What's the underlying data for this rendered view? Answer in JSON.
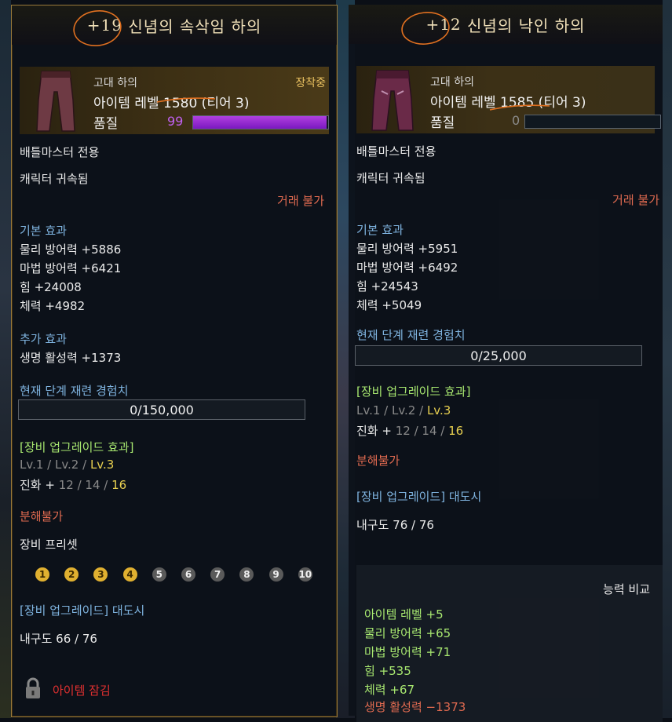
{
  "left": {
    "title_plus": "+19",
    "title_name": " 신념의 속삭임 하의",
    "item_type": "고대 하의",
    "equipped": "장착중",
    "level_prefix": "아이템 레벨 ",
    "level_value": "1580",
    "tier": " (티어 3)",
    "quality_label": "품질",
    "quality_value": "99",
    "quality": 0.99,
    "class_req": "배틀마스터 전용",
    "bound": "캐릭터 귀속됨",
    "trade": "거래 불가",
    "base_title": "기본 효과",
    "base": [
      "물리 방어력 +5886",
      "마법 방어력 +6421",
      "힘 +24008",
      "체력 +4982"
    ],
    "extra_title": "추가 효과",
    "extra": [
      "생명 활성력 +1373"
    ],
    "xp_title": "현재 단계 재련 경험치",
    "xp_value": "0/150,000",
    "upgrade_title": "[장비 업그레이드 효과]",
    "upgrade_lv12": "Lv.1 / Lv.2 / ",
    "upgrade_lv3": "Lv.3",
    "evo_prefix": "진화 + ",
    "evo_gray": "12 / 14 / ",
    "evo_yellow": "16",
    "disassemble": "분해불가",
    "preset_title": "장비 프리셋",
    "presets": [
      "1",
      "2",
      "3",
      "4",
      "5",
      "6",
      "7",
      "8",
      "9",
      "10"
    ],
    "presets_active": 4,
    "upgrade_city": "[장비 업그레이드] 대도시",
    "durability": "내구도 66 / 76",
    "lock_label": "아이템 잠김"
  },
  "right": {
    "title_plus": "+12",
    "title_name": " 신념의 낙인 하의",
    "item_type": "고대 하의",
    "level_prefix": "아이템 레벨 ",
    "level_value": "1585",
    "tier": " (티어 3)",
    "quality_label": "품질",
    "quality_value": "0",
    "quality": 0,
    "class_req": "배틀마스터 전용",
    "bound": "캐릭터 귀속됨",
    "trade": "거래 불가",
    "base_title": "기본 효과",
    "base": [
      "물리 방어력 +5951",
      "마법 방어력 +6492",
      "힘 +24543",
      "체력 +5049"
    ],
    "xp_title": "현재 단계 재련 경험치",
    "xp_value": "0/25,000",
    "upgrade_title": "[장비 업그레이드 효과]",
    "upgrade_lv12": "Lv.1 / Lv.2 / ",
    "upgrade_lv3": "Lv.3",
    "evo_prefix": "진화 + ",
    "evo_gray": "12 / 14 / ",
    "evo_yellow": "16",
    "disassemble": "분해불가",
    "upgrade_city": "[장비 업그레이드] 대도시",
    "durability": "내구도 76 / 76",
    "compare_title": "능력 비교",
    "compare": [
      "아이템 레벨 +5",
      "물리 방어력 +65",
      "마법 방어력 +71",
      "힘 +535",
      "체력 +67"
    ],
    "compare_negative": "생명 활성력 −1373"
  },
  "colors": {
    "section": "#7fb4e0",
    "warning": "#e06a50",
    "positive": "#a8e870",
    "highlight": "#e8d050",
    "quality_purple": "#9a30d8",
    "border_gold": "#9a7a3a"
  }
}
